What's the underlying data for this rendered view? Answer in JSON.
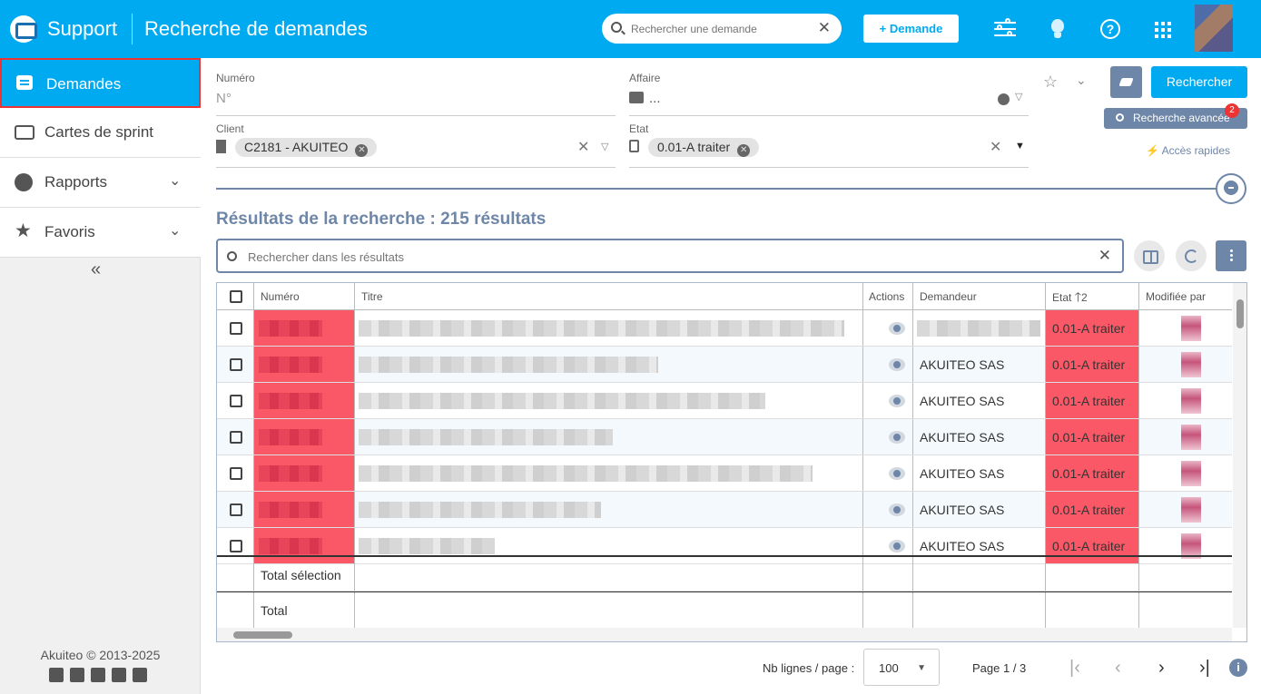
{
  "header": {
    "app_name": "Support",
    "page_title": "Recherche de demandes",
    "search_placeholder": "Rechercher une demande",
    "new_button": "+ Demande",
    "icons": [
      "sliders-icon",
      "lightbulb-icon",
      "help-icon",
      "apps-grid-icon",
      "avatar"
    ],
    "accent": "#00aaf0"
  },
  "sidebar": {
    "items": [
      {
        "label": "Demandes",
        "icon": "chat-icon",
        "active": true
      },
      {
        "label": "Cartes de sprint",
        "icon": "cards-icon"
      },
      {
        "label": "Rapports",
        "icon": "chart-icon",
        "expandable": true
      },
      {
        "label": "Favoris",
        "icon": "star-icon",
        "expandable": true
      }
    ],
    "collapse": "«",
    "copyright": "Akuiteo © 2013-2025"
  },
  "filters": {
    "numero": {
      "label": "Numéro",
      "placeholder": "N°"
    },
    "affaire": {
      "label": "Affaire",
      "value": "..."
    },
    "client": {
      "label": "Client",
      "chip": "C2181 - AKUITEO"
    },
    "etat": {
      "label": "Etat",
      "chip": "0.01-A traiter"
    }
  },
  "actions": {
    "search": "Rechercher",
    "advanced": "Recherche avancée",
    "advanced_badge": "2",
    "quick_access": "Accès rapides"
  },
  "results": {
    "title": "Résultats de la recherche : 215 résultats",
    "search_placeholder": "Rechercher dans les résultats",
    "columns": [
      "Numéro",
      "Titre",
      "Actions",
      "Demandeur",
      "Etat",
      "Modifiée par"
    ],
    "sort_indicator": "2",
    "rows": [
      {
        "demandeur": "",
        "etat": "0.01-A traiter"
      },
      {
        "demandeur": "AKUITEO SAS",
        "etat": "0.01-A traiter"
      },
      {
        "demandeur": "AKUITEO SAS",
        "etat": "0.01-A traiter"
      },
      {
        "demandeur": "AKUITEO SAS",
        "etat": "0.01-A traiter"
      },
      {
        "demandeur": "AKUITEO SAS",
        "etat": "0.01-A traiter"
      },
      {
        "demandeur": "AKUITEO SAS",
        "etat": "0.01-A traiter"
      },
      {
        "demandeur": "AKUITEO SAS",
        "etat": "0.01-A traiter"
      }
    ],
    "total_selection": "Total sélection",
    "total": "Total",
    "etat_color": "#fb5867"
  },
  "pagination": {
    "label": "Nb lignes / page :",
    "page_size": "100",
    "page_info": "Page 1 / 3"
  }
}
